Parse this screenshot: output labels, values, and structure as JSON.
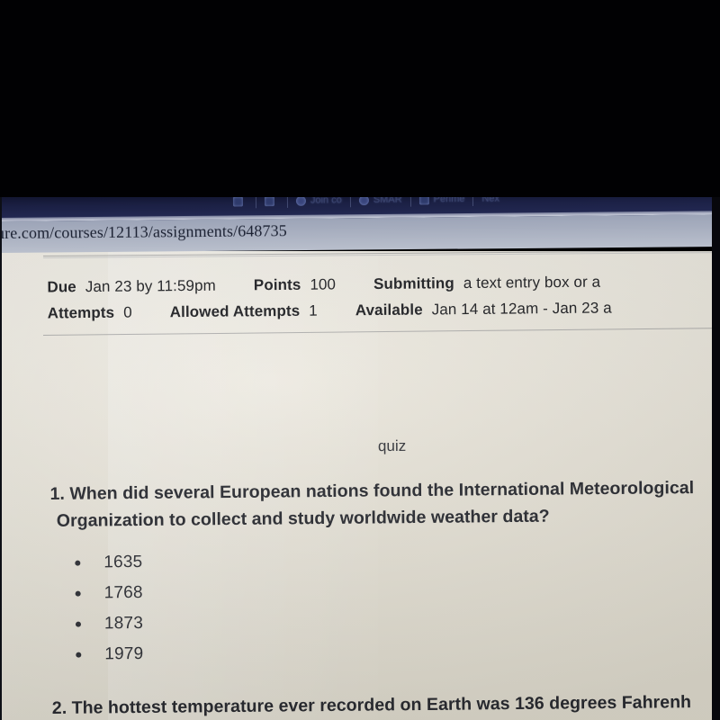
{
  "browser": {
    "bookmarks": [
      {
        "label": "",
        "icon": "bookmark-icon"
      },
      {
        "label": "",
        "icon": "bookmark-icon"
      },
      {
        "label": "Join co",
        "icon": "bookmark-icon"
      },
      {
        "label": "SMAR",
        "icon": "globe-icon"
      },
      {
        "label": "Perime",
        "icon": "bookmark-icon"
      },
      {
        "label": "Nex",
        "icon": "bookmark-icon"
      }
    ],
    "url": "ure.com/courses/12113/assignments/648735"
  },
  "assignment": {
    "fields": [
      {
        "key": "Due",
        "value": "Jan 23 by 11:59pm"
      },
      {
        "key": "Points",
        "value": "100"
      },
      {
        "key": "Submitting",
        "value": "a text entry box or a"
      },
      {
        "key": "Attempts",
        "value": "0"
      },
      {
        "key": "Allowed Attempts",
        "value": "1"
      },
      {
        "key": "Available",
        "value": "Jan 14 at 12am - Jan 23 a"
      }
    ]
  },
  "content": {
    "title": "quiz",
    "question1": {
      "line1": "1. When did several European nations found the International Meteorological",
      "line2": "Organization to collect and study worldwide weather data?",
      "choices": [
        "1635",
        "1768",
        "1873",
        "1979"
      ]
    },
    "question2": {
      "line1": "2. The hottest temperature ever recorded on Earth was 136 degrees Fahrenh"
    }
  },
  "colors": {
    "page_background": "#e7e3d8",
    "chrome_bookmark_bar": "#1b2044",
    "url_bar": "#a6adbe",
    "text": "#23252c",
    "photo_border": "#010103"
  }
}
